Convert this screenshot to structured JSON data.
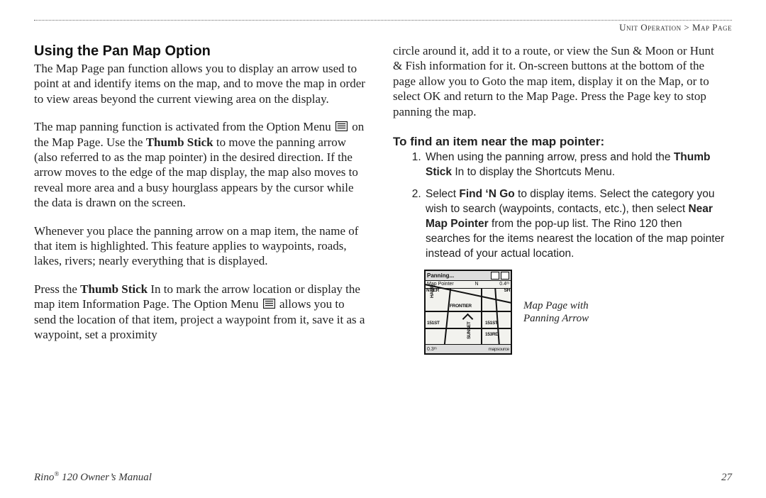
{
  "header": {
    "section": "Unit Operation",
    "separator": " > ",
    "subsection": "Map Page"
  },
  "left": {
    "heading": "Using the Pan Map Option",
    "p1": "The Map Page pan function allows you to display an arrow used to point at and identify items on the map, and to move the map in order to view areas beyond the current viewing area on the display.",
    "p2a": "The map panning function is activated from the Option Menu ",
    "p2b": " on the Map Page. Use the ",
    "p2c": "Thumb Stick",
    "p2d": " to move the panning arrow (also referred to as the map pointer) in the desired direction. If the arrow moves to the edge of the map display, the map also moves to reveal more area and a busy hourglass appears by the cursor while the data is drawn on the screen.",
    "p3": "Whenever you place the panning arrow on a map item, the name of that item is highlighted. This feature applies to waypoints, roads, lakes, rivers; nearly everything that is displayed.",
    "p4a": "Press the ",
    "p4b": "Thumb Stick",
    "p4c": " In to mark the arrow location or display the map item Information Page. The Option Menu ",
    "p4d": " allows you to send the location of that item, project a waypoint from it, save it as a waypoint, set a proximity "
  },
  "right": {
    "p_cont": "circle around it, add it to a route, or view the Sun & Moon or Hunt & Fish information for it. On-screen buttons at the bottom of the page allow you to Goto the map item, display it on the Map, or to select OK and return to the Map Page. Press the Page key to stop panning the map.",
    "sub_heading": "To find an item near the map pointer:",
    "step1a": "When using the panning arrow, press and hold the ",
    "step1b": "Thumb Stick",
    "step1c": " In to display the Shortcuts Menu.",
    "step2a": "Select ",
    "step2b": "Find ‘N Go",
    "step2c": " to display items. Select the category you wish to search (waypoints, contacts, etc.), then select ",
    "step2d": "Near Map Pointer",
    "step2e": " from the pop-up list. The Rino 120 then searches for the items nearest the location of the map pointer instead of your actual location.",
    "screen": {
      "top_label": "Panning...",
      "sub_left": "Map Pointer",
      "sub_mid": "N",
      "sub_right": "0.4ᵐ",
      "st_ntier": "NTIER",
      "st_sh": "SH",
      "st_hamil": "HAMIL",
      "st_frontier": "FRONTIER",
      "st_151st_a": "151ST",
      "st_sunset": "SUNSET",
      "st_151st_b": "151ST",
      "st_153rd": "153RD",
      "bottom_left": "0.3ᵐ",
      "bottom_right": "mapsource"
    },
    "caption_line1": "Map Page with",
    "caption_line2": "Panning Arrow"
  },
  "footer": {
    "product": "Rino",
    "reg": "®",
    "model_suffix": " 120 Owner’s Manual",
    "page_number": "27"
  }
}
